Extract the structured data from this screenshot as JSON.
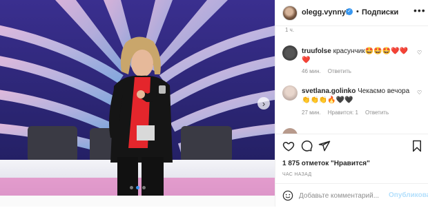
{
  "header": {
    "username": "olegg.vynnyk",
    "follow_label": "Подписки",
    "more_icon": "more-horizontal-icon",
    "verified_icon": "verified-badge-icon"
  },
  "comments": {
    "top_time": "1 ч.",
    "items": [
      {
        "username": "truufolse",
        "text": "красунчик🤩🤩🤩❤️❤️❤️",
        "time": "46 мин.",
        "reply_label": "Ответить"
      },
      {
        "username": "svetlana.golinko",
        "text": "Чекаємо вечора 👏👏👏🔥🖤🖤",
        "time": "27 мин.",
        "likes_label": "Нравится: 1",
        "reply_label": "Ответить"
      }
    ]
  },
  "actions": {
    "likes_text": "1 875 отметок \"Нравится\"",
    "posted_ago": "ЧАС НАЗАД",
    "comment_placeholder": "Добавьте комментарий...",
    "post_label": "Опубликовать"
  },
  "photo": {
    "slide_index": 2,
    "slide_count": 3
  },
  "colors": {
    "accent": "#3897f0",
    "stage_blue": "#2b2a7a",
    "jacket_red": "#e4262c"
  }
}
